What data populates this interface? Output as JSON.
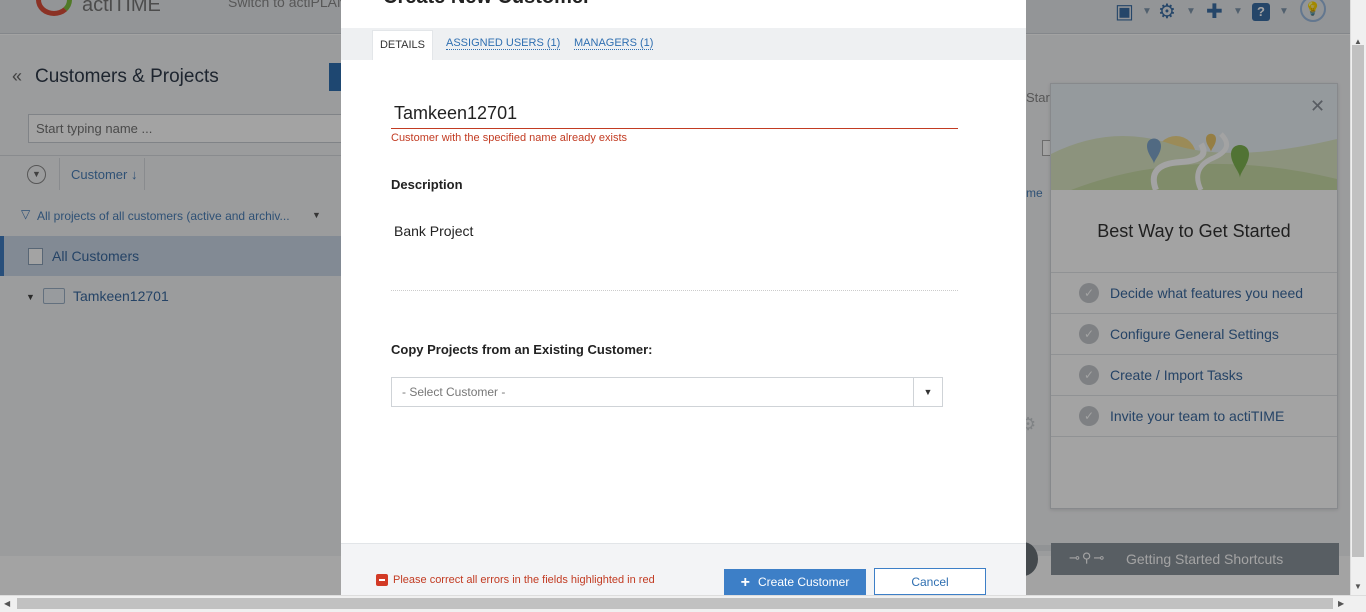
{
  "app": {
    "logo_text": "actiTIME",
    "switch_text": "Switch to actiPLANS"
  },
  "left_panel": {
    "title": "Customers & Projects",
    "search_placeholder": "Start typing name ...",
    "column_header": "Customer",
    "filter_text": "All projects of all customers (active and archiv...",
    "all_customers_label": "All Customers",
    "tree_item": "Tamkeen12701"
  },
  "right_peek": {
    "star_text": "Star",
    "me_text": "me"
  },
  "getting_started": {
    "title": "Best Way to Get Started",
    "items": [
      {
        "label": "Decide what features you need"
      },
      {
        "label": "Configure General Settings"
      },
      {
        "label": "Create / Import Tasks"
      },
      {
        "label": "Invite your team to actiTIME"
      }
    ],
    "shortcuts_label": "Getting Started Shortcuts"
  },
  "modal": {
    "title": "Create New Customer",
    "tabs": [
      {
        "label": "DETAILS",
        "active": true
      },
      {
        "label": "ASSIGNED USERS (1)",
        "active": false
      },
      {
        "label": "MANAGERS (1)",
        "active": false
      }
    ],
    "name_value": "Tamkeen12701",
    "name_error": "Customer with the specified name already exists",
    "description_label": "Description",
    "description_value": "Bank Project",
    "copy_label": "Copy Projects from an Existing Customer:",
    "select_placeholder": "- Select Customer -",
    "footer_error": "Please correct all errors in the fields highlighted in red",
    "create_label": "Create Customer",
    "cancel_label": "Cancel"
  },
  "colors": {
    "accent": "#3d7fc7",
    "error": "#c23b22",
    "link": "#2f6fb1"
  },
  "icons": [
    "collapse-icon",
    "sort-icon",
    "filter-icon",
    "list-icon",
    "folder-icon",
    "close-icon",
    "check-icon",
    "map-pin-icon",
    "gear-icon",
    "puzzle-icon",
    "help-icon",
    "lightbulb-icon",
    "plus-icon",
    "error-icon",
    "chevron-down-icon"
  ]
}
